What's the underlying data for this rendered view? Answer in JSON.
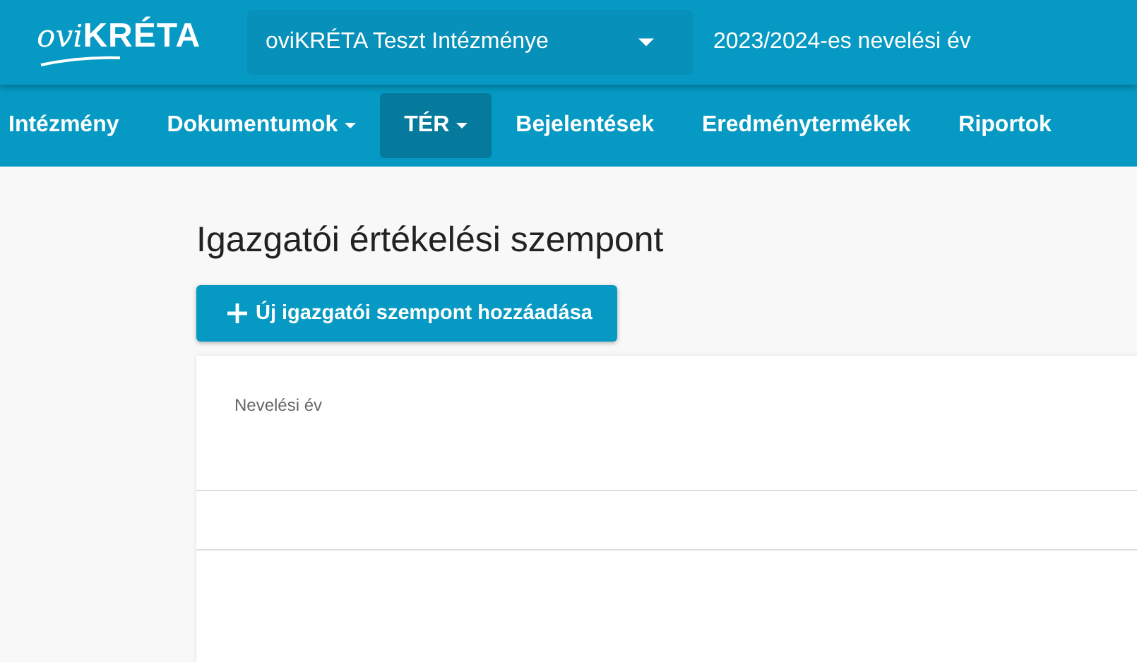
{
  "logo": {
    "script_part": "ovi",
    "main_part": "KRÉTA"
  },
  "institution_select": {
    "value": "oviKRÉTA Teszt Intézménye"
  },
  "school_year": "2023/2024-es nevelési év",
  "nav": [
    {
      "label": "Intézmény",
      "dropdown": false,
      "selected": false
    },
    {
      "label": "Dokumentumok",
      "dropdown": true,
      "selected": false
    },
    {
      "label": "TÉR",
      "dropdown": true,
      "selected": true
    },
    {
      "label": "Bejelentések",
      "dropdown": false,
      "selected": false
    },
    {
      "label": "Eredménytermékek",
      "dropdown": false,
      "selected": false
    },
    {
      "label": "Riportok",
      "dropdown": false,
      "selected": false
    }
  ],
  "page_title": "Igazgatói értékelési szempont",
  "add_button": "Új igazgatói szempont hozzáadása",
  "table": {
    "columns": [
      "Nevelési év"
    ]
  }
}
